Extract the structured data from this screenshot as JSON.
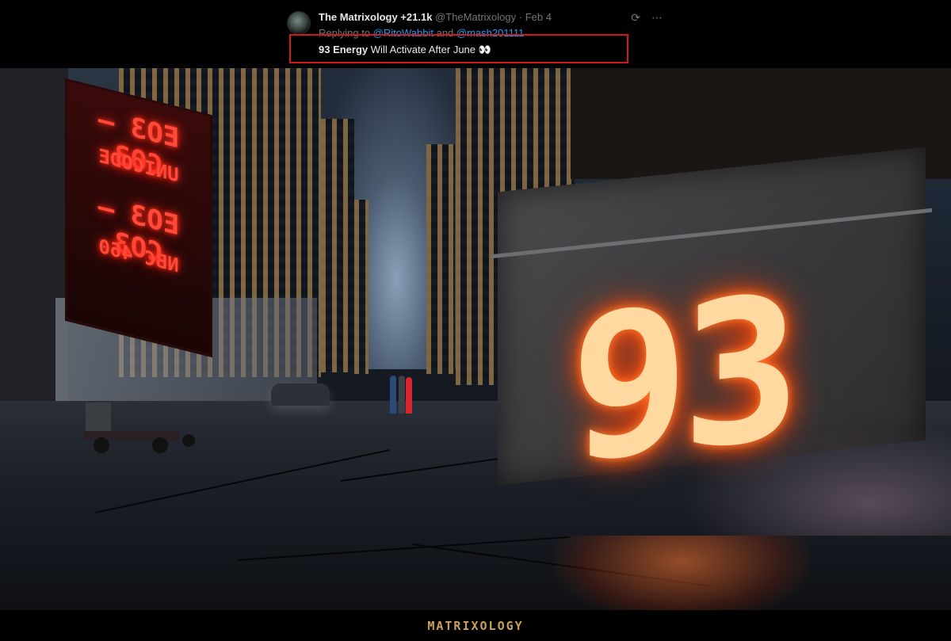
{
  "tweet": {
    "author_name": "The Matrixology",
    "followers": "+21.1k",
    "handle": "@TheMatrixology",
    "separator": "·",
    "date": "Feb 4",
    "replying_prefix": "Replying to",
    "reply_handle_1": "@RitoWabbit",
    "reply_and": "and",
    "reply_handle_2": "@mash201111",
    "text_bold": "93 Energy",
    "text_rest": "Will Activate After June 👀"
  },
  "icons": {
    "refresh": "refresh-icon",
    "more": "more-icon"
  },
  "scene": {
    "big_number": "93",
    "sign_line_1": "EO3 — CO3",
    "sign_line_2": "UNICODE",
    "sign_line_3": "EO3 — CO3",
    "sign_line_4": "NBC 460"
  },
  "footer": {
    "brand": "MATRIXOLOGY"
  },
  "colors": {
    "accent_red": "#d11a1a",
    "link_blue": "#1d9bf0",
    "brand_gold": "#c9a15a",
    "neon_orange": "#ff7a30"
  }
}
